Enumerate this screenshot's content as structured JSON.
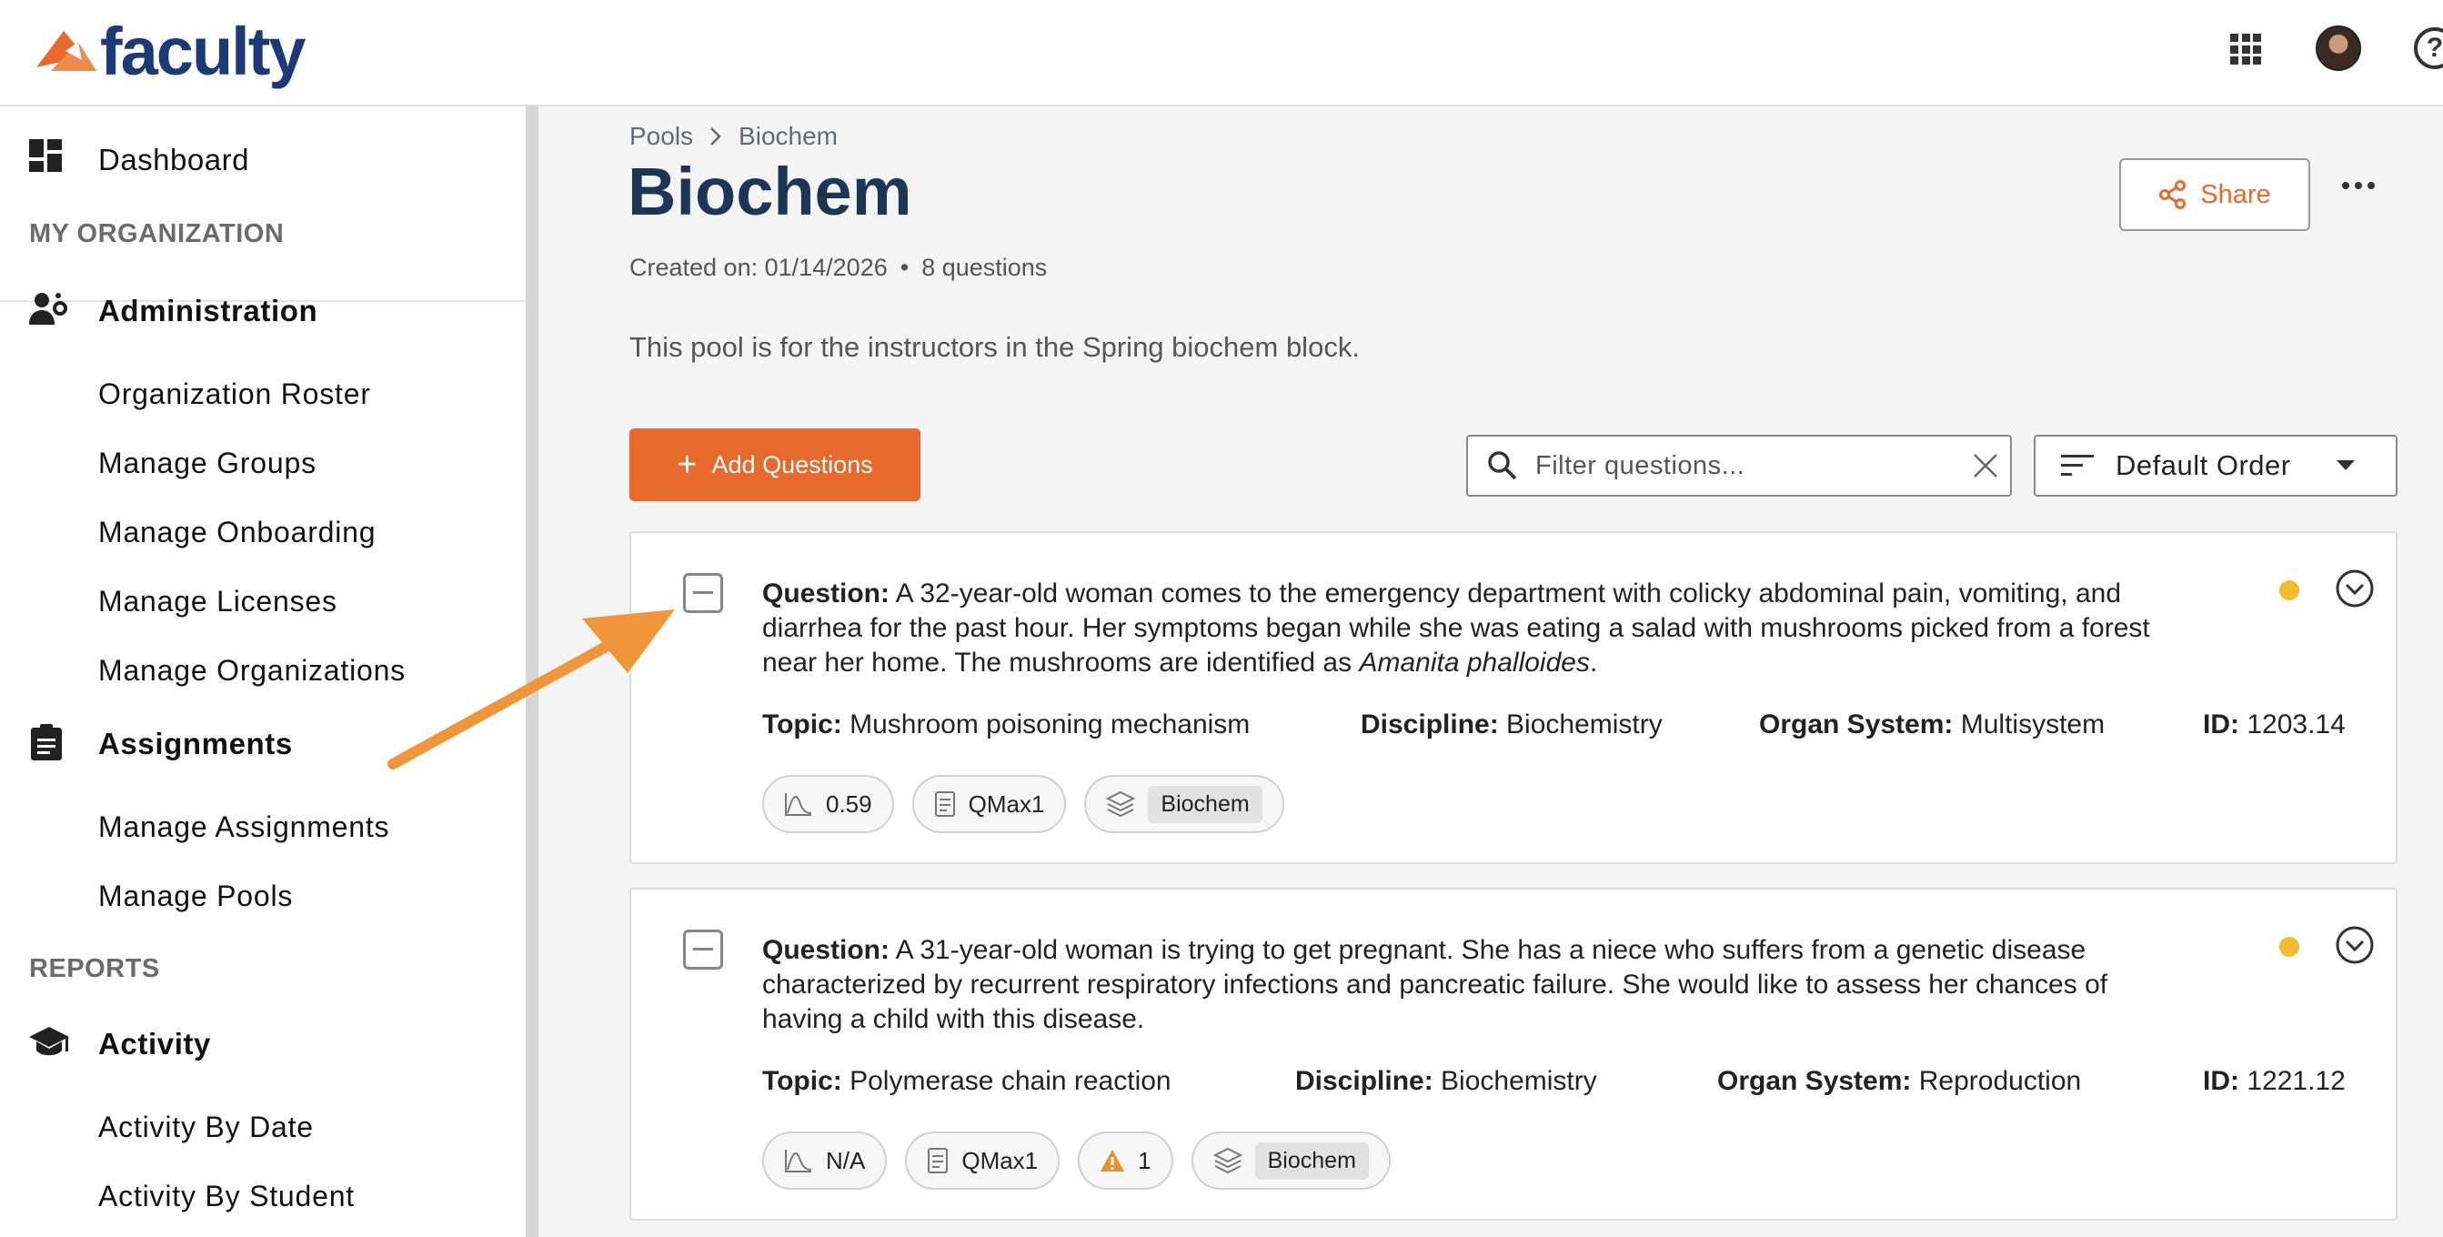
{
  "brand": {
    "name": "faculty",
    "accent": "#e66a2c",
    "navy": "#1d3557"
  },
  "topbar": {
    "apps_icon": "apps-grid-icon",
    "avatar": "user-avatar",
    "help_icon": "help-icon",
    "help_glyph": "?"
  },
  "sidebar": {
    "dashboard": "Dashboard",
    "section_org": "MY ORGANIZATION",
    "administration": {
      "label": "Administration",
      "items": [
        "Organization Roster",
        "Manage Groups",
        "Manage Onboarding",
        "Manage Licenses",
        "Manage Organizations"
      ]
    },
    "assignments": {
      "label": "Assignments",
      "items": [
        "Manage Assignments",
        "Manage Pools"
      ]
    },
    "section_reports": "REPORTS",
    "activity": {
      "label": "Activity",
      "items": [
        "Activity By Date",
        "Activity By Student"
      ]
    }
  },
  "breadcrumb": [
    "Pools",
    "Biochem"
  ],
  "page": {
    "title": "Biochem",
    "created": "Created on: 01/14/2026",
    "bullet": "•",
    "count": "8 questions",
    "description": "This pool is for the instructors in the Spring biochem block."
  },
  "toolbar": {
    "share_label": "Share",
    "add_label": "Add Questions",
    "filter_placeholder": "Filter questions...",
    "order_label": "Default Order"
  },
  "questions": [
    {
      "label": "Question:",
      "text_a": " A 32-year-old woman comes to the emergency department with colicky abdominal pain, vomiting, and diarrhea for the past hour. Her symptoms began while she was eating a salad with mushrooms picked from a forest near her home. The mushrooms are identified as ",
      "text_italic": "Amanita phalloides",
      "text_b": ".",
      "topic_label": "Topic:",
      "topic": " Mushroom poisoning mechanism",
      "discipline_label": "Discipline:",
      "discipline": " Biochemistry",
      "organ_label": "Organ System:",
      "organ": " Multisystem",
      "id_label": "ID:",
      "id": " 1203.14",
      "difficulty": "0.59",
      "source": "QMax1",
      "pool_tag": "Biochem"
    },
    {
      "label": "Question:",
      "text_a": " A 31-year-old woman is trying to get pregnant. She has a niece who suffers from a genetic disease characterized by recurrent respiratory infections and pancreatic failure. She would like to assess her chances of having a child with this disease.",
      "text_italic": "",
      "text_b": "",
      "topic_label": "Topic:",
      "topic": " Polymerase chain reaction",
      "discipline_label": "Discipline:",
      "discipline": " Biochemistry",
      "organ_label": "Organ System:",
      "organ": " Reproduction",
      "id_label": "ID:",
      "id": " 1221.12",
      "difficulty": "N/A",
      "source": "QMax1",
      "warnings": "1",
      "pool_tag": "Biochem"
    }
  ],
  "annotation": {
    "arrow_color": "#f0953a"
  }
}
